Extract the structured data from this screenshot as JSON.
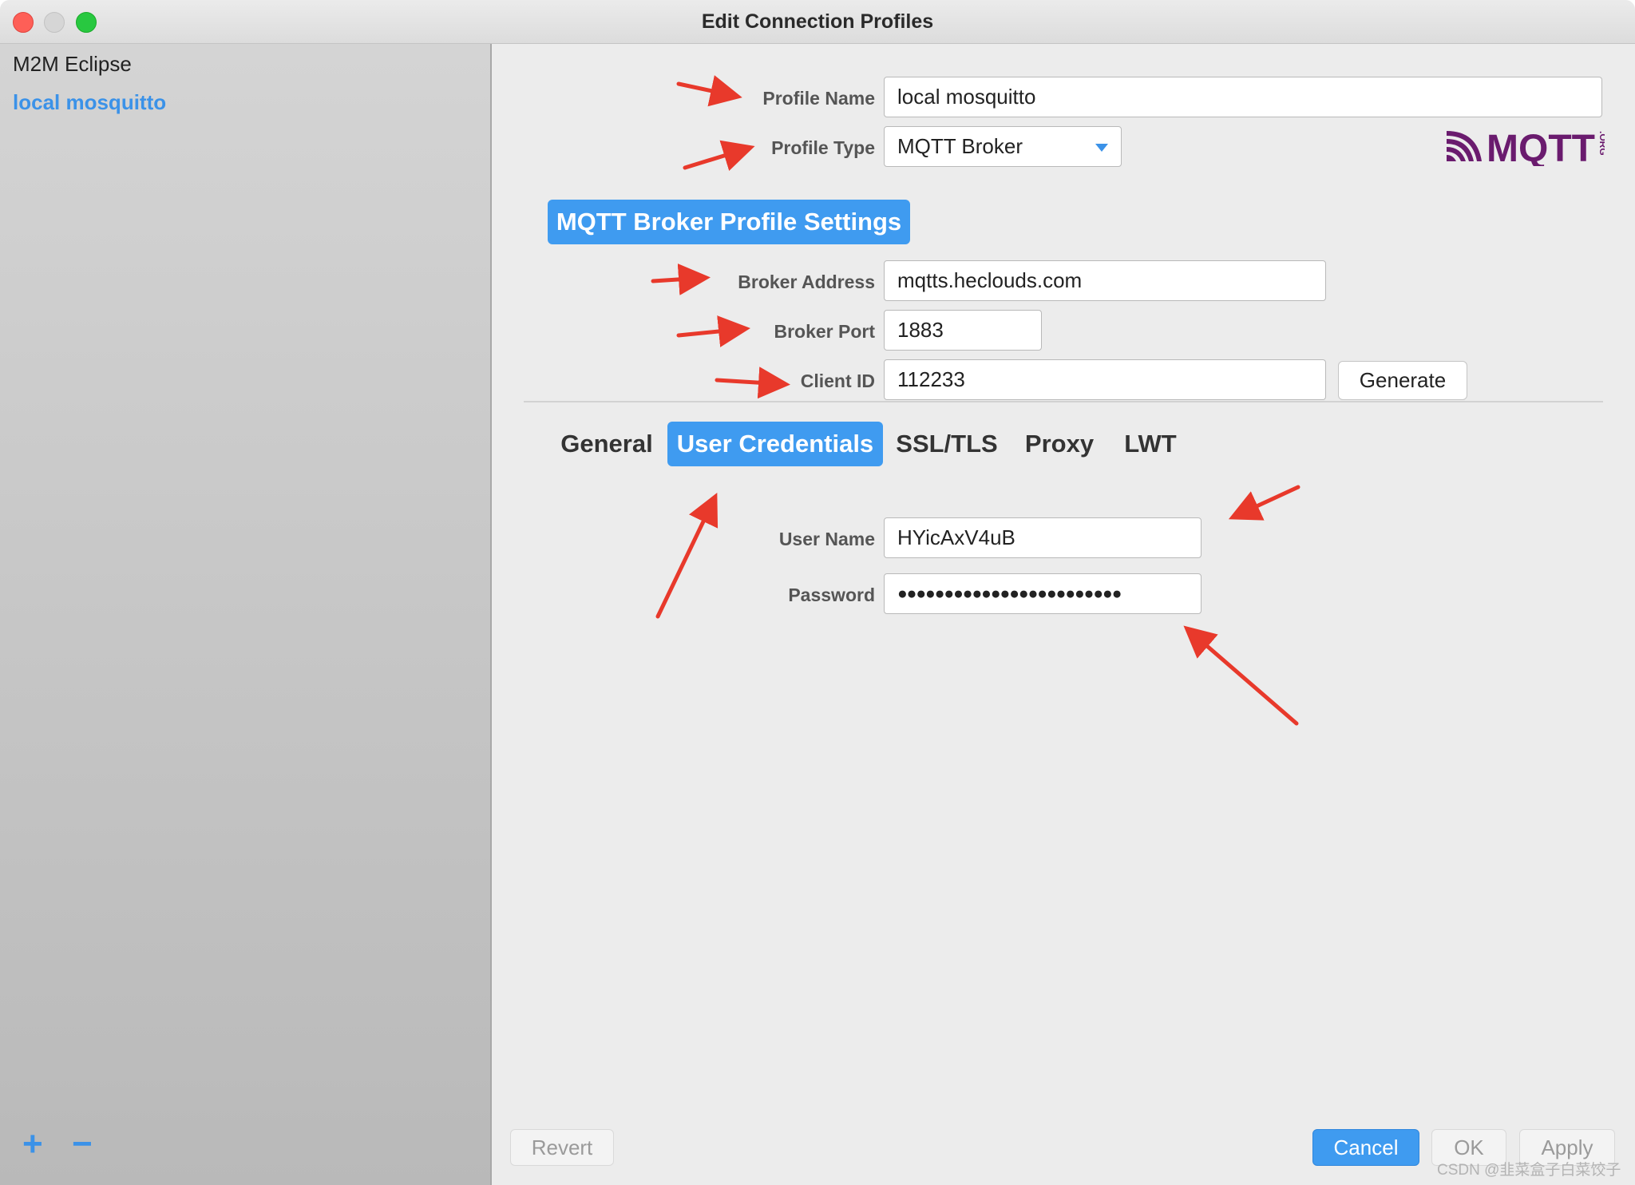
{
  "window": {
    "title": "Edit Connection Profiles"
  },
  "sidebar": {
    "items": [
      {
        "label": "M2M Eclipse",
        "selected": false
      },
      {
        "label": "local mosquitto",
        "selected": true
      }
    ],
    "add_label": "+",
    "remove_label": "−"
  },
  "profile": {
    "name_label": "Profile Name",
    "name_value": "local mosquitto",
    "type_label": "Profile Type",
    "type_value": "MQTT Broker",
    "logo_text": "MQTT",
    "logo_suffix": ".ORG"
  },
  "broker": {
    "header": "MQTT Broker Profile Settings",
    "address_label": "Broker Address",
    "address_value": "mqtts.heclouds.com",
    "port_label": "Broker Port",
    "port_value": "1883",
    "client_id_label": "Client ID",
    "client_id_value": "112233",
    "generate_label": "Generate"
  },
  "tabs": [
    {
      "label": "General",
      "active": false
    },
    {
      "label": "User Credentials",
      "active": true
    },
    {
      "label": "SSL/TLS",
      "active": false
    },
    {
      "label": "Proxy",
      "active": false
    },
    {
      "label": "LWT",
      "active": false
    }
  ],
  "credentials": {
    "username_label": "User Name",
    "username_value": "HYicAxV4uB",
    "password_label": "Password",
    "password_value": "●●●●●●●●●●●●●●●●●●●●●●●●"
  },
  "footer": {
    "revert_label": "Revert",
    "cancel_label": "Cancel",
    "ok_label": "OK",
    "apply_label": "Apply"
  },
  "watermark": "CSDN @韭菜盒子白菜饺子",
  "colors": {
    "accent": "#3f9bf0",
    "annotation_arrow": "#e8392b",
    "close": "#fe5f57",
    "maximize": "#28c840",
    "mqtt_logo": "#6a1b6e"
  }
}
